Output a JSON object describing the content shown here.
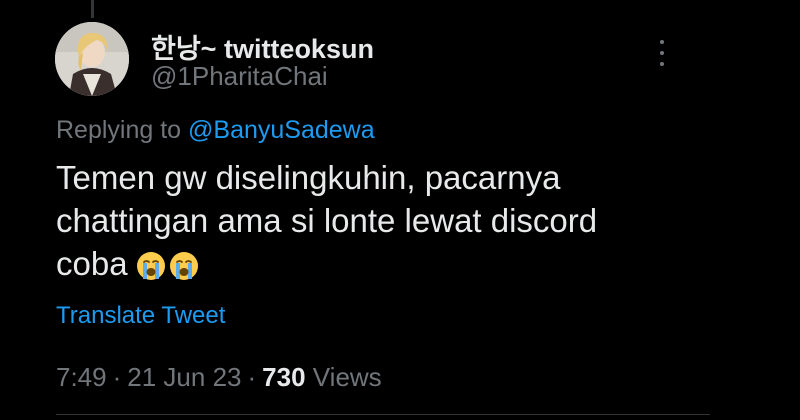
{
  "tweet": {
    "display_name": "한낭~ twitteoksun",
    "handle": "@1PharitaChai",
    "replying_prefix": "Replying to",
    "replying_to": "@BanyuSadewa",
    "text_lines": [
      "Temen gw diselingkuhin, pacarnya",
      "chattingan ama si lonte lewat discord",
      "coba"
    ],
    "emojis": [
      "loudly-crying-face",
      "loudly-crying-face"
    ],
    "translate_label": "Translate Tweet",
    "time": "7:49",
    "date": "21 Jun 23",
    "separator": "·",
    "views_count": "730",
    "views_label": "Views"
  },
  "icons": {
    "more": "more-vertical-icon",
    "avatar": "avatar-image"
  },
  "colors": {
    "background": "#000000",
    "primary_text": "#e7e9ea",
    "secondary_text": "#71767b",
    "link": "#1d9bf0",
    "divider": "#2f3336"
  }
}
